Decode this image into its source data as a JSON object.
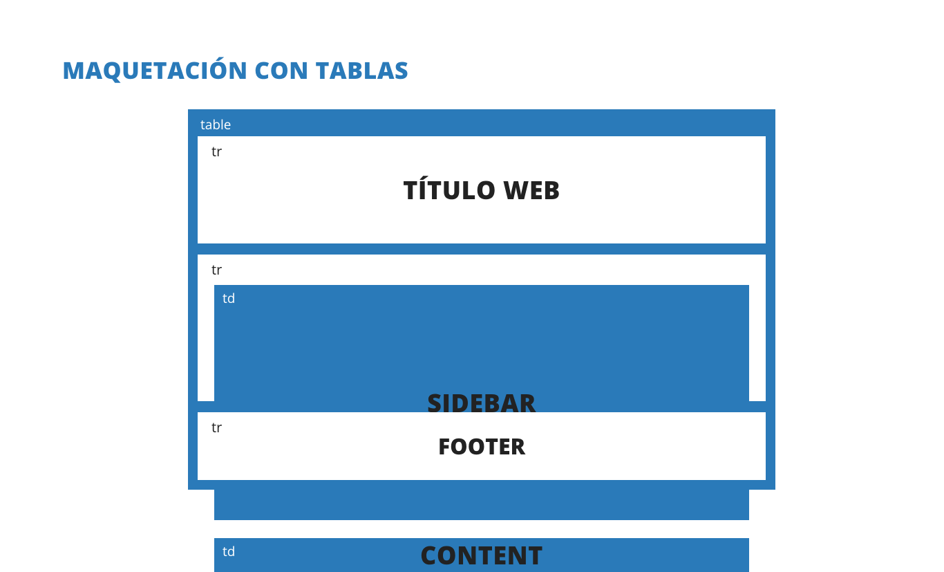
{
  "title": "MAQUETACIÓN CON TABLAS",
  "table": {
    "label": "table",
    "rows": [
      {
        "label": "tr",
        "heading": "TÍTULO WEB"
      },
      {
        "label": "tr",
        "cells": [
          {
            "label": "td",
            "heading": "SIDEBAR"
          },
          {
            "label": "td",
            "heading": "CONTENT"
          }
        ]
      },
      {
        "label": "tr",
        "heading": "FOOTER"
      }
    ]
  },
  "colors": {
    "primary": "#2a7ab9",
    "text": "#222222",
    "background": "#ffffff"
  }
}
